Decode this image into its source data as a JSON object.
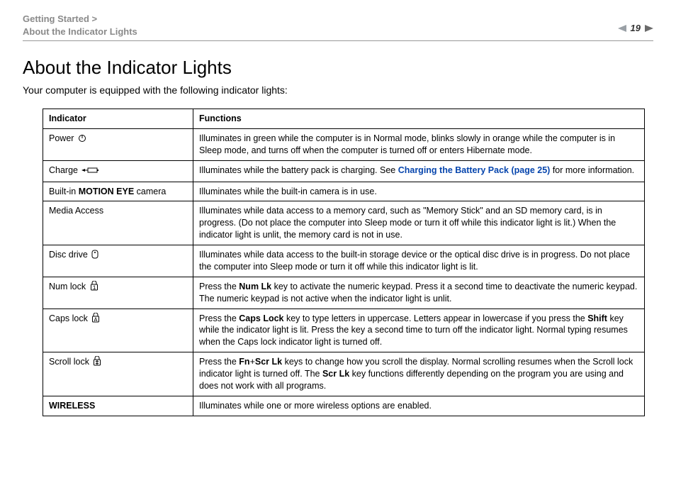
{
  "header": {
    "breadcrumb_line1": "Getting Started >",
    "breadcrumb_line2": "About the Indicator Lights",
    "page_arrow_desc": "N",
    "page_number": "19"
  },
  "title": "About the Indicator Lights",
  "intro": "Your computer is equipped with the following indicator lights:",
  "table": {
    "head_indicator": "Indicator",
    "head_functions": "Functions",
    "rows": {
      "power": {
        "label": "Power",
        "icon": "power-icon",
        "func": "Illuminates in green while the computer is in Normal mode, blinks slowly in orange while the computer is in Sleep mode, and turns off when the computer is turned off or enters Hibernate mode."
      },
      "charge": {
        "label": "Charge",
        "icon": "charge-icon",
        "func_pre": "Illuminates while the battery pack is charging. See ",
        "func_link": "Charging the Battery Pack (page 25)",
        "func_post": " for more information."
      },
      "camera": {
        "pre": "Built-in ",
        "bold": "MOTION EYE",
        "post": " camera",
        "func": "Illuminates while the built-in camera is in use."
      },
      "media": {
        "label": "Media Access",
        "func": "Illuminates while data access to a memory card, such as \"Memory Stick\" and an SD memory card, is in progress. (Do not place the computer into Sleep mode or turn it off while this indicator light is lit.) When the indicator light is unlit, the memory card is not in use."
      },
      "disc": {
        "label": "Disc drive",
        "icon": "disc-icon",
        "func": "Illuminates while data access to the built-in storage device or the optical disc drive is in progress. Do not place the computer into Sleep mode or turn it off while this indicator light is lit."
      },
      "numlock": {
        "label": "Num lock",
        "icon": "numlock-icon",
        "pre": "Press the ",
        "b1": "Num Lk",
        "post": " key to activate the numeric keypad. Press it a second time to deactivate the numeric keypad. The numeric keypad is not active when the indicator light is unlit."
      },
      "capslock": {
        "label": "Caps lock",
        "icon": "capslock-icon",
        "pre": "Press the ",
        "b1": "Caps Lock",
        "mid1": " key to type letters in uppercase. Letters appear in lowercase if you press the ",
        "b2": "Shift",
        "post": " key while the indicator light is lit. Press the key a second time to turn off the indicator light. Normal typing resumes when the Caps lock indicator light is turned off."
      },
      "scrolllock": {
        "label": "Scroll lock",
        "icon": "scrolllock-icon",
        "pre": "Press the ",
        "b1": "Fn",
        "plus": "+",
        "b2": "Scr Lk",
        "mid": " keys to change how you scroll the display. Normal scrolling resumes when the Scroll lock indicator light is turned off. The ",
        "b3": "Scr Lk",
        "post": " key functions differently depending on the program you are using and does not work with all programs."
      },
      "wireless": {
        "label": "WIRELESS",
        "func": "Illuminates while one or more wireless options are enabled."
      }
    }
  }
}
